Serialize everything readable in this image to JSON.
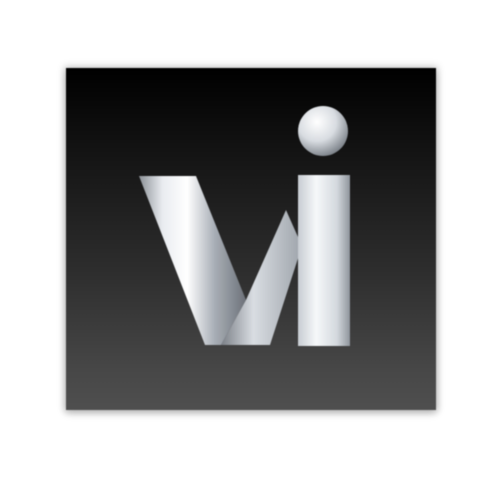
{
  "icon": {
    "name": "vi-app-icon",
    "logo_text": "vi",
    "colors": {
      "background_top": "#000000",
      "background_bottom": "#4f4f4f",
      "metal_light": "#f4f6f9",
      "metal_mid": "#b9bec6",
      "metal_dark": "#6f747b"
    }
  }
}
